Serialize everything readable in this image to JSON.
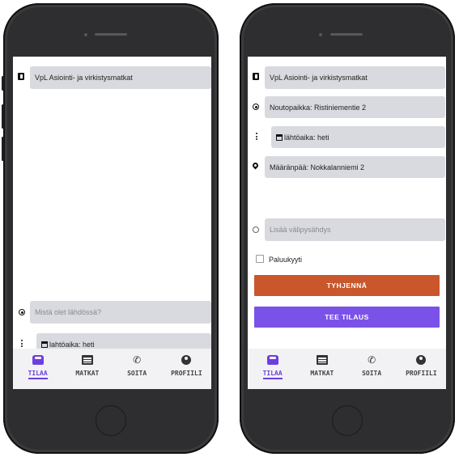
{
  "left": {
    "category": "VpL Asiointi- ja virkistysmatkat",
    "pickup_placeholder": "Mistä olet lähdössä?",
    "departure_time": "lahtöaika: heti",
    "nav": [
      {
        "label": "TILAA",
        "icon": "car-icon",
        "active": true
      },
      {
        "label": "MATKAT",
        "icon": "list-icon",
        "active": false
      },
      {
        "label": "SOITA",
        "icon": "phone-icon",
        "active": false
      },
      {
        "label": "PROFIILI",
        "icon": "profile-icon",
        "active": false
      }
    ]
  },
  "right": {
    "category": "VpL Asiointi- ja virkistysmatkat",
    "pickup": "Noutopaikka: Ristiniementie 2",
    "departure_time": "lähtöaika: heti",
    "destination": "Määränpää: Nokkalanniemi 2",
    "add_stop_placeholder": "Lisää välipysähdys",
    "return_trip_label": "Paluukyyti",
    "clear_button": "TYHJENNÄ",
    "order_button": "TEE TILAUS",
    "nav": [
      {
        "label": "TILAA",
        "icon": "car-icon",
        "active": true
      },
      {
        "label": "MATKAT",
        "icon": "list-icon",
        "active": false
      },
      {
        "label": "SOITA",
        "icon": "phone-icon",
        "active": false
      },
      {
        "label": "PROFIILI",
        "icon": "profile-icon",
        "active": false
      }
    ]
  },
  "colors": {
    "accent": "#6c3fe0",
    "clear_button": "#c9572b",
    "order_button": "#7b52e8",
    "field_bg": "#d9dadf"
  }
}
